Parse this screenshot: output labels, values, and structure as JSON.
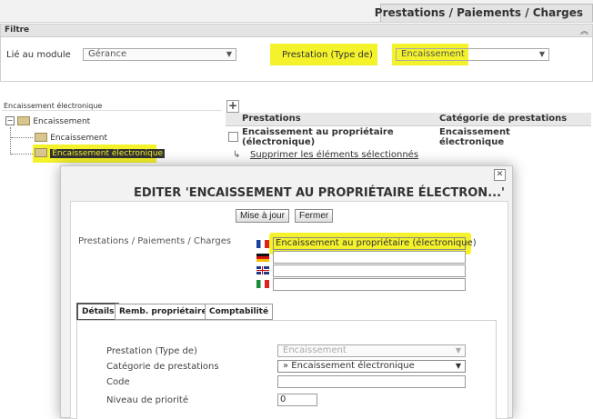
{
  "header": {
    "title": "Prestations / Paiements / Charges"
  },
  "filter": {
    "title": "Filtre",
    "collapse_icon": "double-chevron-up-icon",
    "lie_label": "Lié au module",
    "lie_value": "Gérance",
    "prestation_type_label": "Prestation (Type de)",
    "prestation_type_value": "Encaissement"
  },
  "tree": {
    "caption": "Encaissement électronique",
    "root": "Encaissement",
    "children": [
      "Encaissement",
      "Encaissement électronique"
    ]
  },
  "list": {
    "add_icon": "plus-icon",
    "col_prestations": "Prestations",
    "col_categorie": "Catégorie de prestations",
    "row_prestation_line1": "Encaissement au propriétaire",
    "row_prestation_line2": "(électronique)",
    "row_categorie_line1": "Encaissement",
    "row_categorie_line2": "électronique",
    "delete_link": "Supprimer les éléments sélectionnés"
  },
  "dialog": {
    "title": "EDITER 'ENCAISSEMENT AU PROPRIÉTAIRE ÉLECTRON...'",
    "close_icon": "close-icon",
    "update_button": "Mise à jour",
    "close_button": "Fermer",
    "name_label": "Prestations / Paiements / Charges",
    "name_fr": "Encaissement au propriétaire (électronique)",
    "name_de": "",
    "name_en": "",
    "name_it": "",
    "tabs": [
      "Détails",
      "Remb. propriétaire",
      "Comptabilité"
    ],
    "details": {
      "prestation_type_label": "Prestation (Type de)",
      "prestation_type_value": "Encaissement",
      "categorie_label": "Catégorie de prestations",
      "categorie_value": "» Encaissement électronique",
      "code_label": "Code",
      "code_value": "",
      "priorite_label": "Niveau de priorité",
      "priorite_value": "0"
    }
  },
  "colors": {
    "highlight": "#f4f22b",
    "header_bg": "#e6e6e6"
  }
}
